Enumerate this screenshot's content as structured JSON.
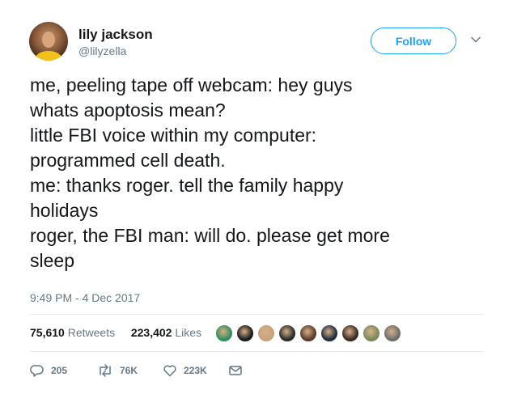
{
  "author": {
    "name": "lily jackson",
    "handle": "@lilyzella"
  },
  "follow_label": "Follow",
  "tweet_lines": [
    "me, peeling tape off webcam: hey guys",
    "whats apoptosis mean?",
    "little FBI voice within my computer:",
    "programmed cell death.",
    "me: thanks roger. tell the family happy",
    "holidays",
    "roger, the FBI man: will do. please get more",
    "sleep"
  ],
  "timestamp": "9:49 PM - 4 Dec 2017",
  "stats": {
    "retweets_count": "75,610",
    "retweets_label": "Retweets",
    "likes_count": "223,402",
    "likes_label": "Likes"
  },
  "likers": [
    {
      "icon": "liker-avatar",
      "color": "#2f8f5b"
    },
    {
      "icon": "liker-avatar",
      "color": "#1a1a1a"
    },
    {
      "icon": "liker-avatar",
      "color": "#c7a27a"
    },
    {
      "icon": "liker-avatar",
      "color": "#2a2a2a"
    },
    {
      "icon": "liker-avatar",
      "color": "#5a3b2b"
    },
    {
      "icon": "liker-avatar",
      "color": "#1f2d3d"
    },
    {
      "icon": "liker-avatar",
      "color": "#3a2a22"
    },
    {
      "icon": "liker-avatar",
      "color": "#7a8a5a"
    },
    {
      "icon": "liker-avatar",
      "color": "#6d6d6d"
    }
  ],
  "actions": {
    "replies": "205",
    "retweets": "76K",
    "likes": "223K"
  },
  "colors": {
    "accent": "#1da1f2",
    "secondary_text": "#657786",
    "divider": "#e6ecf0"
  }
}
